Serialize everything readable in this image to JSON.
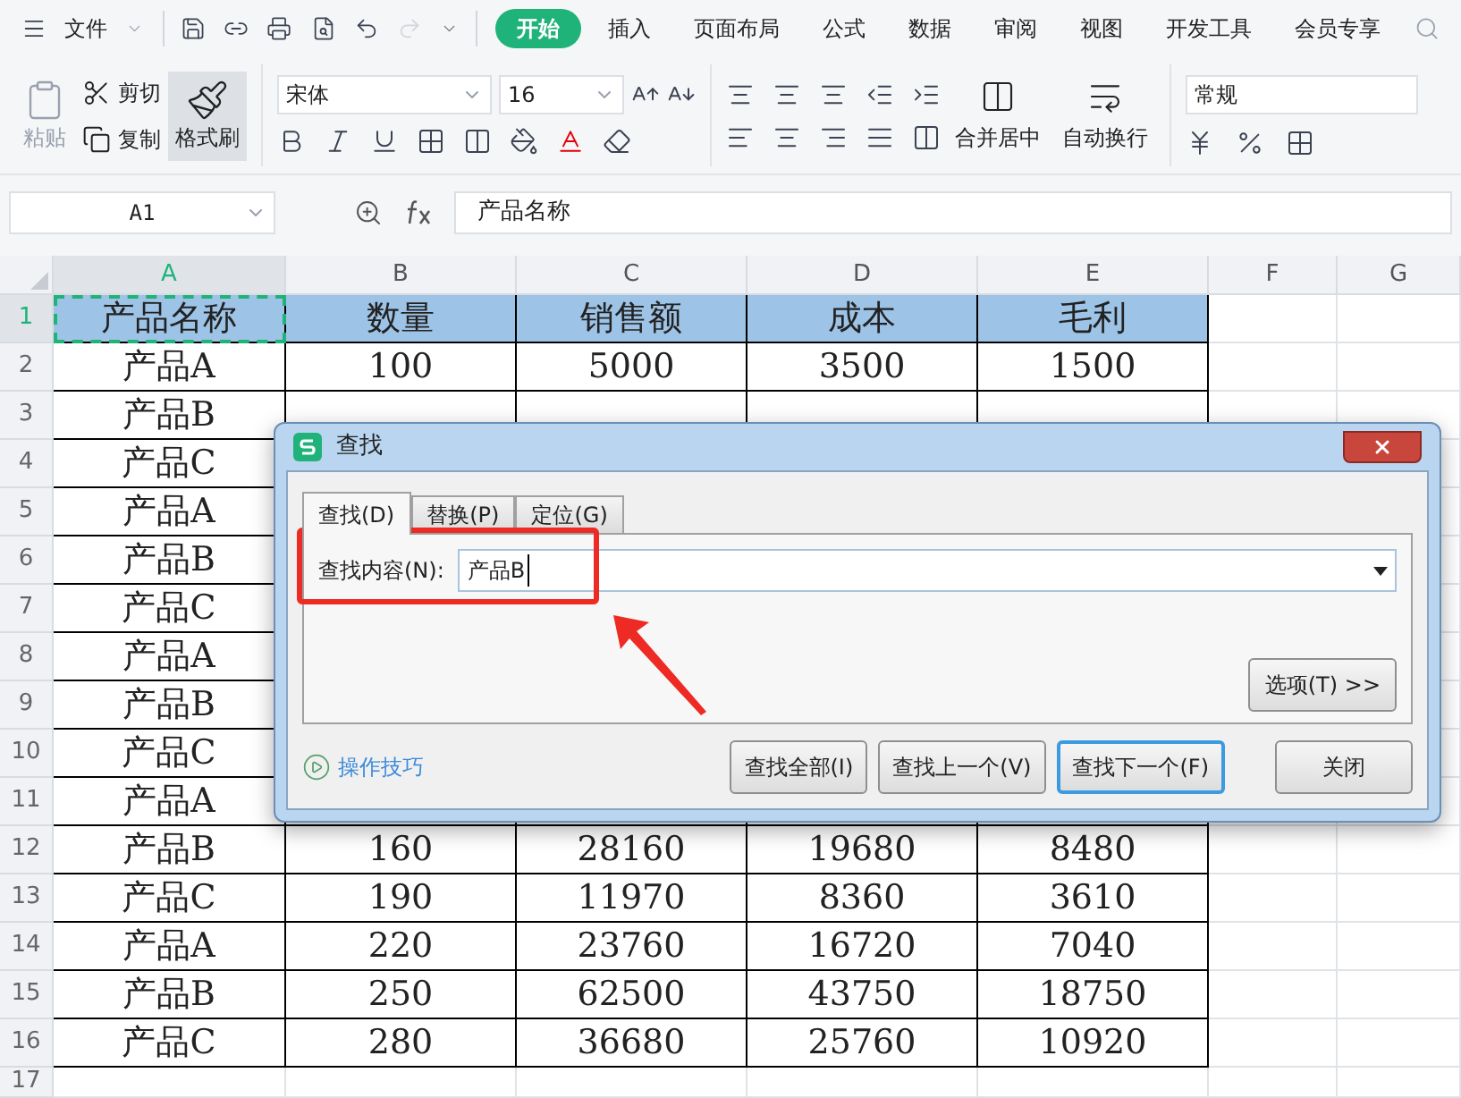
{
  "menu_bar": {
    "file_menu": "文件",
    "tabs": [
      {
        "label": "开始",
        "selected": true
      },
      {
        "label": "插入",
        "selected": false
      },
      {
        "label": "页面布局",
        "selected": false
      },
      {
        "label": "公式",
        "selected": false
      },
      {
        "label": "数据",
        "selected": false
      },
      {
        "label": "审阅",
        "selected": false
      },
      {
        "label": "视图",
        "selected": false
      },
      {
        "label": "开发工具",
        "selected": false
      },
      {
        "label": "会员专享",
        "selected": false
      }
    ]
  },
  "ribbon": {
    "paste": {
      "label": "粘贴",
      "disabled": true
    },
    "cut": "剪切",
    "copy": "复制",
    "format_painter": {
      "label": "格式刷",
      "selected": true
    },
    "font_name": "宋体",
    "font_size": "16",
    "merge_center": "合并居中",
    "wrap_text": "自动换行",
    "number_format": "常规"
  },
  "formula_bar": {
    "cell_ref": "A1",
    "formula": "产品名称"
  },
  "sheet": {
    "columns": [
      {
        "label": "A",
        "selected": true
      },
      {
        "label": "B",
        "selected": false
      },
      {
        "label": "C",
        "selected": false
      },
      {
        "label": "D",
        "selected": false
      },
      {
        "label": "E",
        "selected": false
      },
      {
        "label": "F",
        "selected": false
      },
      {
        "label": "G",
        "selected": false
      }
    ],
    "rows": [
      {
        "number": "1",
        "selected": true,
        "kind": "header",
        "cells": [
          "产品名称",
          "数量",
          "销售额",
          "成本",
          "毛利"
        ]
      },
      {
        "number": "2",
        "selected": false,
        "kind": "data",
        "cells": [
          "产品A",
          "100",
          "5000",
          "3500",
          "1500"
        ]
      },
      {
        "number": "3",
        "selected": false,
        "kind": "data",
        "cells": [
          "产品B"
        ]
      },
      {
        "number": "4",
        "selected": false,
        "kind": "data",
        "cells": [
          "产品C"
        ]
      },
      {
        "number": "5",
        "selected": false,
        "kind": "data",
        "cells": [
          "产品A"
        ]
      },
      {
        "number": "6",
        "selected": false,
        "kind": "data",
        "cells": [
          "产品B"
        ]
      },
      {
        "number": "7",
        "selected": false,
        "kind": "data",
        "cells": [
          "产品C"
        ]
      },
      {
        "number": "8",
        "selected": false,
        "kind": "data",
        "cells": [
          "产品A"
        ]
      },
      {
        "number": "9",
        "selected": false,
        "kind": "data",
        "cells": [
          "产品B"
        ]
      },
      {
        "number": "10",
        "selected": false,
        "kind": "data",
        "cells": [
          "产品C"
        ]
      },
      {
        "number": "11",
        "selected": false,
        "kind": "data",
        "cells": [
          "产品A"
        ]
      },
      {
        "number": "12",
        "selected": false,
        "kind": "data",
        "cells": [
          "产品B",
          "160",
          "28160",
          "19680",
          "8480"
        ]
      },
      {
        "number": "13",
        "selected": false,
        "kind": "data",
        "cells": [
          "产品C",
          "190",
          "11970",
          "8360",
          "3610"
        ]
      },
      {
        "number": "14",
        "selected": false,
        "kind": "data",
        "cells": [
          "产品A",
          "220",
          "23760",
          "16720",
          "7040"
        ]
      },
      {
        "number": "15",
        "selected": false,
        "kind": "data",
        "cells": [
          "产品B",
          "250",
          "62500",
          "43750",
          "18750"
        ]
      },
      {
        "number": "16",
        "selected": false,
        "kind": "data",
        "cells": [
          "产品C",
          "280",
          "36680",
          "25760",
          "10920"
        ]
      },
      {
        "number": "17",
        "selected": false,
        "kind": "empty",
        "cells": []
      }
    ]
  },
  "find_dialog": {
    "title": "查找",
    "tabs": [
      {
        "label": "查找(D)",
        "selected": true
      },
      {
        "label": "替换(P)",
        "selected": false
      },
      {
        "label": "定位(G)",
        "selected": false
      }
    ],
    "find_label": "查找内容(N):",
    "find_value": "产品B",
    "options_button": "选项(T) >>",
    "tips_link": "操作技巧",
    "buttons": [
      {
        "label": "查找全部(I)",
        "focused": false
      },
      {
        "label": "查找上一个(V)",
        "focused": false
      },
      {
        "label": "查找下一个(F)",
        "focused": true
      },
      {
        "label": "关闭",
        "focused": false
      }
    ]
  }
}
